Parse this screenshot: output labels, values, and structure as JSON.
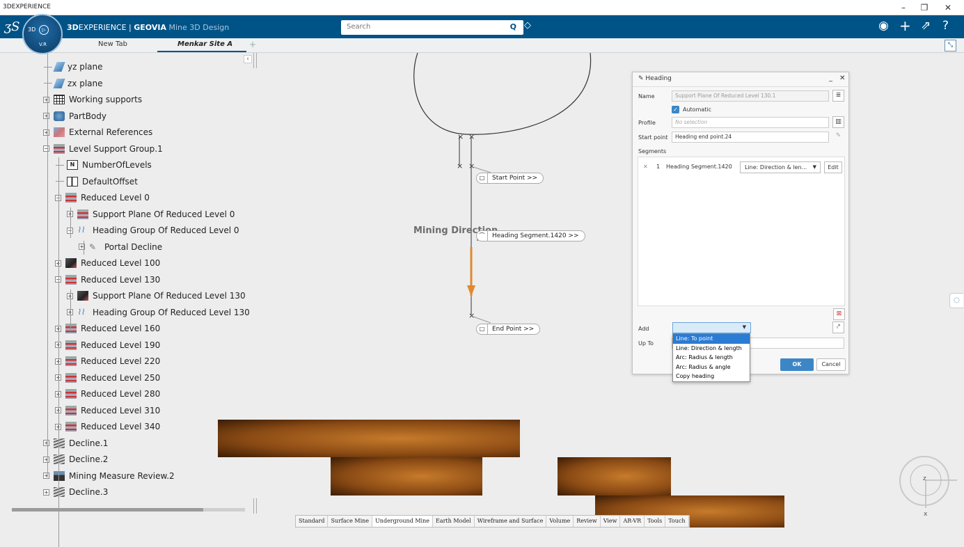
{
  "titlebar": {
    "title": "3DEXPERIENCE",
    "minimize": "–",
    "restore": "❐",
    "close": "✕"
  },
  "appbar": {
    "brand_bold": "3D",
    "brand_rest": "EXPERIENCE | ",
    "brand_app": "GEOVIA",
    "brand_sub": " Mine 3D Design",
    "compass_3d": "3D",
    "compass_vr": "V.R",
    "search_placeholder": "Search"
  },
  "tabs": {
    "new_tab": "New Tab",
    "active_tab": "Menkar Site A",
    "plus": "+"
  },
  "tree": [
    {
      "label": "yz plane",
      "icon": "plane-icon",
      "depth": 1,
      "pm": ""
    },
    {
      "label": "zx plane",
      "icon": "plane-icon",
      "depth": 1,
      "pm": ""
    },
    {
      "label": "Working supports",
      "icon": "grid-icon",
      "depth": 1,
      "pm": "+"
    },
    {
      "label": "PartBody",
      "icon": "body-icon",
      "depth": 1,
      "pm": "+"
    },
    {
      "label": "External References",
      "icon": "ext-icon",
      "depth": 1,
      "pm": "+"
    },
    {
      "label": "Level Support Group.1",
      "icon": "level-icon",
      "depth": 1,
      "pm": "−"
    },
    {
      "label": "NumberOfLevels",
      "icon": "param-icon",
      "depth": 2,
      "pm": ""
    },
    {
      "label": "DefaultOffset",
      "icon": "offset-icon",
      "depth": 2,
      "pm": ""
    },
    {
      "label": "Reduced Level 0",
      "icon": "level-icon",
      "depth": 2,
      "pm": "−"
    },
    {
      "label": "Support Plane Of Reduced Level 0",
      "icon": "level-icon",
      "depth": 3,
      "pm": "+"
    },
    {
      "label": "Heading Group Of Reduced Level 0",
      "icon": "heading-icon",
      "depth": 3,
      "pm": "−"
    },
    {
      "label": "Portal Decline",
      "icon": "pen-icon",
      "depth": 4,
      "pm": "+"
    },
    {
      "label": "Reduced Level 100",
      "icon": "support-icon",
      "depth": 2,
      "pm": "+"
    },
    {
      "label": "Reduced Level 130",
      "icon": "level-icon",
      "depth": 2,
      "pm": "−"
    },
    {
      "label": "Support Plane Of Reduced Level 130",
      "icon": "support-icon",
      "depth": 3,
      "pm": "+"
    },
    {
      "label": "Heading Group Of Reduced Level 130",
      "icon": "heading-icon",
      "depth": 3,
      "pm": "+"
    },
    {
      "label": "Reduced Level 160",
      "icon": "level-icon",
      "depth": 2,
      "pm": "+"
    },
    {
      "label": "Reduced Level 190",
      "icon": "level-icon",
      "depth": 2,
      "pm": "+"
    },
    {
      "label": "Reduced Level 220",
      "icon": "level-icon",
      "depth": 2,
      "pm": "+"
    },
    {
      "label": "Reduced Level 250",
      "icon": "level-icon",
      "depth": 2,
      "pm": "+"
    },
    {
      "label": "Reduced Level 280",
      "icon": "level-icon",
      "depth": 2,
      "pm": "+"
    },
    {
      "label": "Reduced Level 310",
      "icon": "level-icon",
      "depth": 2,
      "pm": "+"
    },
    {
      "label": "Reduced Level 340",
      "icon": "level-icon",
      "depth": 2,
      "pm": "+"
    },
    {
      "label": "Decline.1",
      "icon": "decline-icon",
      "depth": 1,
      "pm": "+"
    },
    {
      "label": "Decline.2",
      "icon": "decline-icon",
      "depth": 1,
      "pm": "+"
    },
    {
      "label": "Mining Measure Review.2",
      "icon": "review-icon",
      "depth": 1,
      "pm": "+"
    },
    {
      "label": "Decline.3",
      "icon": "decline-icon",
      "depth": 1,
      "pm": "+"
    }
  ],
  "viewport": {
    "start_point": "Start Point >>",
    "heading_segment": "Heading Segment.1420 >>",
    "end_point": "End Point >>",
    "mining_direction": "Mining Direction"
  },
  "dialog": {
    "title": "Heading",
    "name_label": "Name",
    "name_value": "Support Plane Of Reduced Level 130.1",
    "automatic_label": "Automatic",
    "profile_label": "Profile",
    "profile_placeholder": "No selection",
    "start_point_label": "Start point",
    "start_point_value": "Heading end point.24",
    "segments_label": "Segments",
    "segment_row": {
      "index": "1",
      "name": "Heading Segment.1420",
      "type": "Line: Direction & len...",
      "edit": "Edit"
    },
    "add_label": "Add",
    "up_to_label": "Up To",
    "ok": "OK",
    "cancel": "Cancel",
    "add_options": [
      "Line: To point",
      "Line: Direction & length",
      "Arc: Radius & length",
      "Arc: Radius & angle",
      "Copy heading"
    ]
  },
  "bottom_tabs": [
    "Standard",
    "Surface Mine",
    "Underground Mine",
    "Earth Model",
    "Wireframe and Surface",
    "Volume",
    "Review",
    "View",
    "AR-VR",
    "Tools",
    "Touch"
  ],
  "compass_axes": {
    "x": "x",
    "z": "z"
  }
}
